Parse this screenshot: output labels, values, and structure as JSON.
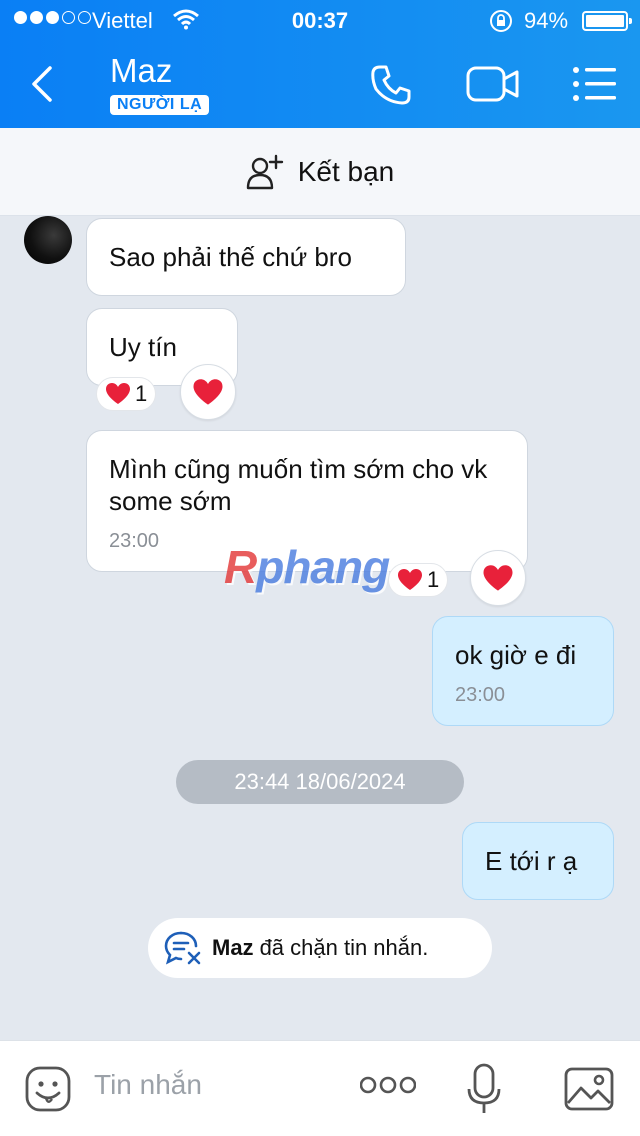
{
  "status_bar": {
    "carrier": "Viettel",
    "time": "00:37",
    "battery": "94%",
    "signal_bars_filled": 3,
    "signal_bars_total": 5
  },
  "header": {
    "contact_name": "Maz",
    "badge": "NGƯỜI LẠ"
  },
  "add_friend": {
    "label": "Kết bạn"
  },
  "messages": [
    {
      "text": "Sao phải thế chứ bro"
    },
    {
      "text": "Uy tín",
      "reaction_count": "1"
    },
    {
      "text": "Mình cũng muốn tìm sớm cho vk some sớm",
      "time": "23:00",
      "reaction_count": "1"
    },
    {
      "text": "ok giờ e đi",
      "time": "23:00"
    }
  ],
  "date_separator": "23:44 18/06/2024",
  "messages_after": [
    {
      "text": "E tới r ạ"
    }
  ],
  "blocked_notice": {
    "name": "Maz",
    "text": "đã chặn tin nhắn."
  },
  "watermark": {
    "first": "R",
    "rest": "phang"
  },
  "input": {
    "placeholder": "Tin nhắn"
  },
  "colors": {
    "header_blue": "#0a7ff5",
    "my_bubble": "#d4efff",
    "chat_bg": "#e3e8ef",
    "heart": "#e8213a"
  }
}
